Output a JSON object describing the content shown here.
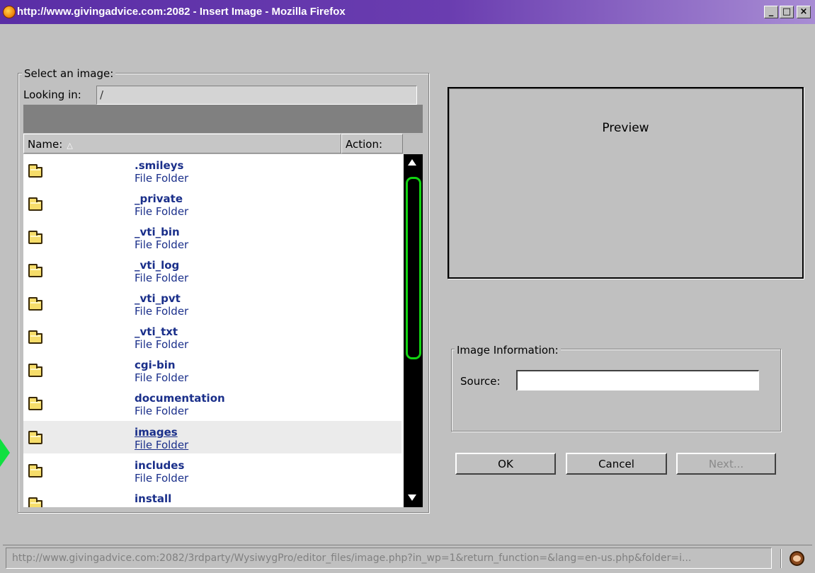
{
  "window": {
    "title": "http://www.givingadvice.com:2082 - Insert Image - Mozilla Firefox",
    "controls": {
      "minimize": "_",
      "maximize": "□",
      "close": "×"
    }
  },
  "browser": {
    "legend": "Select an image:",
    "looking_in_label": "Looking in:",
    "looking_in_value": "/",
    "columns": {
      "name": "Name:",
      "sort_indicator": "△",
      "action": "Action:"
    },
    "items": [
      {
        "name": ".smileys",
        "type": "File Folder"
      },
      {
        "name": "_private",
        "type": "File Folder"
      },
      {
        "name": "_vti_bin",
        "type": "File Folder"
      },
      {
        "name": "_vti_log",
        "type": "File Folder"
      },
      {
        "name": "_vti_pvt",
        "type": "File Folder"
      },
      {
        "name": "_vti_txt",
        "type": "File Folder"
      },
      {
        "name": "cgi-bin",
        "type": "File Folder"
      },
      {
        "name": "documentation",
        "type": "File Folder"
      },
      {
        "name": "images",
        "type": "File Folder"
      },
      {
        "name": "includes",
        "type": "File Folder"
      },
      {
        "name": "install",
        "type": ""
      }
    ],
    "selected_item": "images"
  },
  "preview": {
    "label": "Preview"
  },
  "image_info": {
    "legend": "Image Information:",
    "source_label": "Source:",
    "source_value": ""
  },
  "buttons": {
    "ok": "OK",
    "cancel": "Cancel",
    "next": "Next..."
  },
  "status_bar": {
    "url": "http://www.givingadvice.com:2082/3rdparty/WysiwygPro/editor_files/image.php?in_wp=1&return_function=&lang=en-us.php&folder=i..."
  },
  "colors": {
    "title_bar": "#5a2ea6",
    "dialog_bg": "#c0c0c0",
    "link_text": "#1a2f8a",
    "scroll_thumb": "#12d412"
  }
}
